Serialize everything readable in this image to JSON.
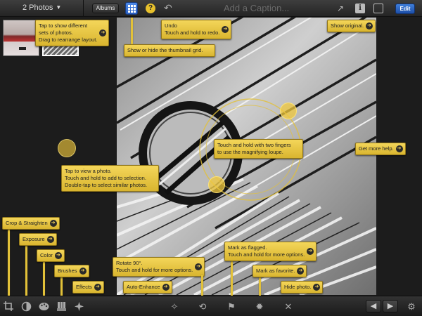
{
  "topbar": {
    "photos_count": "2 Photos",
    "albums_label": "Albums",
    "help_label": "?",
    "caption_placeholder": "Add a Caption...",
    "info_label": "i",
    "edit_label": "Edit"
  },
  "callouts": {
    "tap_sets": [
      "Tap to show different",
      "sets of photos.",
      "Drag to rearrange layout."
    ],
    "thumb_grid": "Show or hide the thumbnail grid.",
    "undo": [
      "Undo",
      "Touch and hold to redo."
    ],
    "show_original": "Show original.",
    "loupe": [
      "Touch and hold with two fingers",
      "to use the magnifying loupe."
    ],
    "more_help": "Get more help.",
    "view_photo": [
      "Tap to view a photo.",
      "Touch and hold to add to selection.",
      "Double-tap to select similar photos."
    ],
    "crop": "Crop & Straighten",
    "exposure": "Exposure",
    "color": "Color",
    "brushes": "Brushes",
    "effects": "Effects",
    "rotate": [
      "Rotate 90°.",
      "Touch and hold for more options."
    ],
    "auto_enhance": "Auto-Enhance",
    "flagged": [
      "Mark as flagged.",
      "Touch and hold for more options."
    ],
    "favorite": "Mark as favorite.",
    "hide": "Hide photo."
  },
  "colors": {
    "callout": "#f1d15a",
    "edit_blue": "#2f6bd0",
    "help_yellow": "#e8c12c"
  },
  "icons": {
    "go": "➔",
    "caret": "▼",
    "undo": "↶",
    "share": "↗",
    "auto_enhance": "✧",
    "rotate": "⟲",
    "flag": "⚑",
    "favorite": "✹",
    "hide": "✕",
    "prev": "◀",
    "next": "▶",
    "settings": "⚙"
  }
}
